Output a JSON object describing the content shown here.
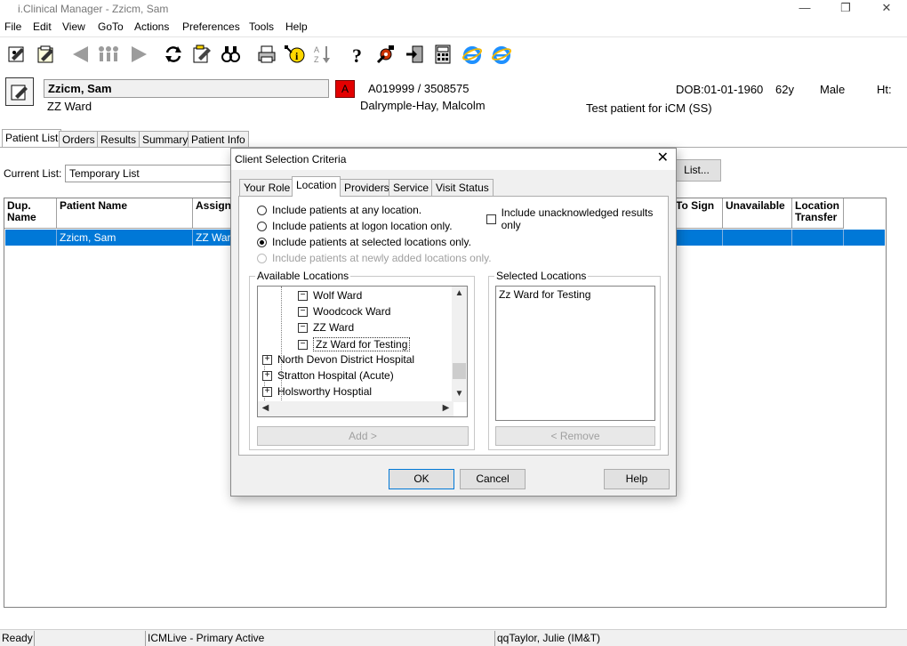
{
  "window": {
    "title": "i.Clinical Manager - Zzicm, Sam",
    "min_icon": "—",
    "max_icon": "❐",
    "close_icon": "✕"
  },
  "menu": [
    "File",
    "Edit",
    "View",
    "GoTo",
    "Actions",
    "Preferences",
    "Tools",
    "Help"
  ],
  "toolbar": {
    "icons": [
      "patient-select-icon",
      "patient-list-icon",
      "back-arrow-icon",
      "people-icon",
      "forward-arrow-icon",
      "refresh-icon",
      "edit-note-icon",
      "search-binoculars-icon",
      "print-icon",
      "info-icon",
      "sort-az-icon",
      "help-question-icon",
      "settings-tools-icon",
      "exit-icon",
      "calculator-icon",
      "ie-browser-icon",
      "ie-browser-2-icon"
    ]
  },
  "patient": {
    "name": "Zzicm, Sam",
    "ward": "ZZ Ward",
    "alert": "A",
    "ids": "A019999 / 3508575",
    "consultant": "Dalrymple-Hay, Malcolm",
    "dob": "DOB:01-01-1960",
    "age": "62y",
    "sex": "Male",
    "ht": "Ht:",
    "note": "Test patient for iCM (SS)"
  },
  "main_tabs": [
    "Patient List",
    "Orders",
    "Results",
    "Summary",
    "Patient Info"
  ],
  "current_list": {
    "label": "Current List:",
    "value": "Temporary List",
    "button": "List..."
  },
  "grid": {
    "headers": [
      "Dup.\nName",
      "Patient Name",
      "Assigne",
      "To Sign",
      "Unavailable",
      "Location\nTransfer"
    ],
    "row": [
      "",
      "Zzicm, Sam",
      "ZZ Ward"
    ]
  },
  "status": {
    "ready": "Ready",
    "env": "ICMLive - Primary Active",
    "user": "qqTaylor, Julie (IM&T)"
  },
  "dialog": {
    "title": "Client Selection Criteria",
    "close": "✕",
    "tabs": [
      "Your Role",
      "Location",
      "Providers",
      "Service",
      "Visit Status"
    ],
    "active_tab": "Location",
    "options": {
      "any": "Include patients at any location.",
      "logon": "Include patients at logon location only.",
      "selected": "Include patients at selected locations only.",
      "newly": "Include patients at newly added locations only.",
      "unack": "Include unacknowledged results only"
    },
    "selected_option": "selected",
    "available_label": "Available Locations",
    "selected_label": "Selected Locations",
    "tree": [
      {
        "label": "Wolf Ward",
        "box": "−"
      },
      {
        "label": "Woodcock Ward",
        "box": "−"
      },
      {
        "label": "ZZ Ward",
        "box": "−"
      },
      {
        "label": "Zz Ward for Testing",
        "box": "−"
      },
      {
        "label": "North Devon District Hospital",
        "box": "+"
      },
      {
        "label": "Stratton Hospital (Acute)",
        "box": "+"
      },
      {
        "label": "Holsworthy Hosptial",
        "box": "+"
      }
    ],
    "selected_locations": [
      "Zz Ward for Testing"
    ],
    "add_button": "Add >",
    "remove_button": "< Remove",
    "ok": "OK",
    "cancel": "Cancel",
    "help": "Help"
  }
}
